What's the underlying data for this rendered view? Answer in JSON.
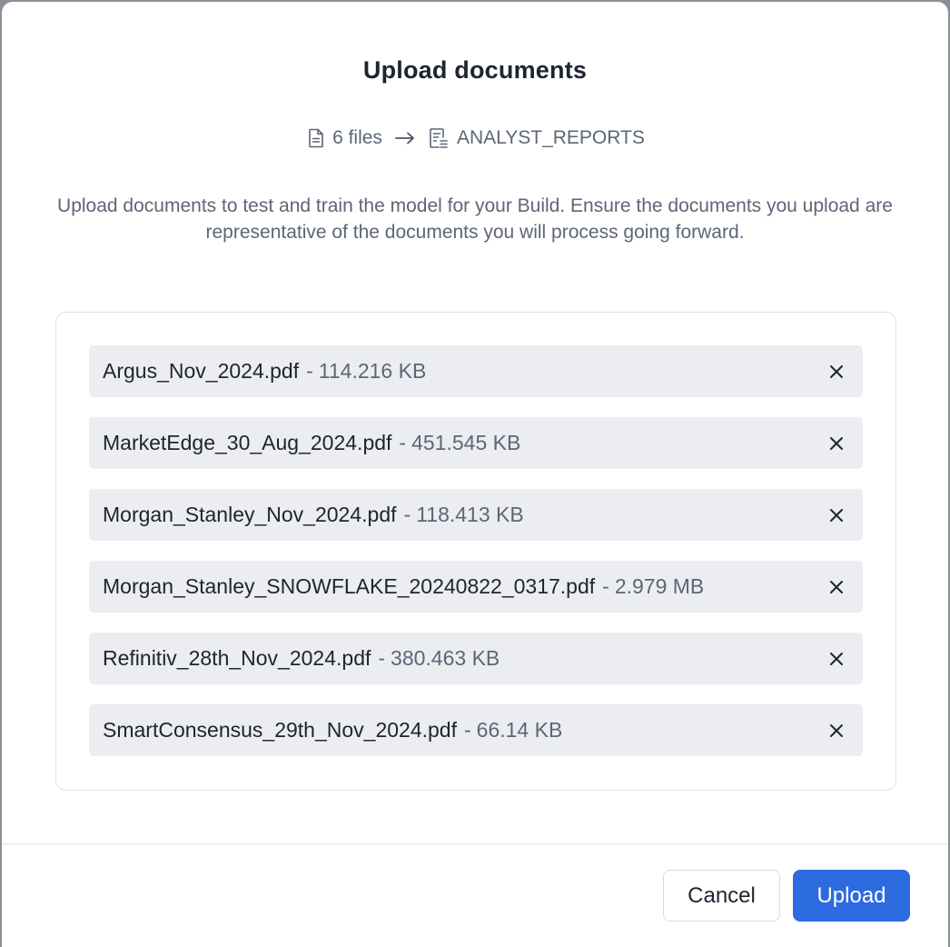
{
  "dialog": {
    "title": "Upload documents",
    "file_count_label": "6 files",
    "destination": "ANALYST_REPORTS",
    "description": "Upload documents to test and train the model for your Build. Ensure the documents you upload are representative of the documents you will process going forward."
  },
  "files": [
    {
      "name": "Argus_Nov_2024.pdf",
      "size": "114.216 KB"
    },
    {
      "name": "MarketEdge_30_Aug_2024.pdf",
      "size": "451.545 KB"
    },
    {
      "name": "Morgan_Stanley_Nov_2024.pdf",
      "size": "118.413 KB"
    },
    {
      "name": "Morgan_Stanley_SNOWFLAKE_20240822_0317.pdf",
      "size": "2.979 MB"
    },
    {
      "name": "Refinitiv_28th_Nov_2024.pdf",
      "size": "380.463 KB"
    },
    {
      "name": "SmartConsensus_29th_Nov_2024.pdf",
      "size": "66.14 KB"
    }
  ],
  "footer": {
    "cancel_label": "Cancel",
    "upload_label": "Upload"
  },
  "colors": {
    "accent": "#2c6bdf",
    "row_background": "#ecedf1",
    "muted_text": "#5d6677"
  },
  "icons": {
    "file": "file-icon",
    "arrow": "arrow-right-icon",
    "destination": "document-list-icon",
    "remove": "close-icon"
  }
}
